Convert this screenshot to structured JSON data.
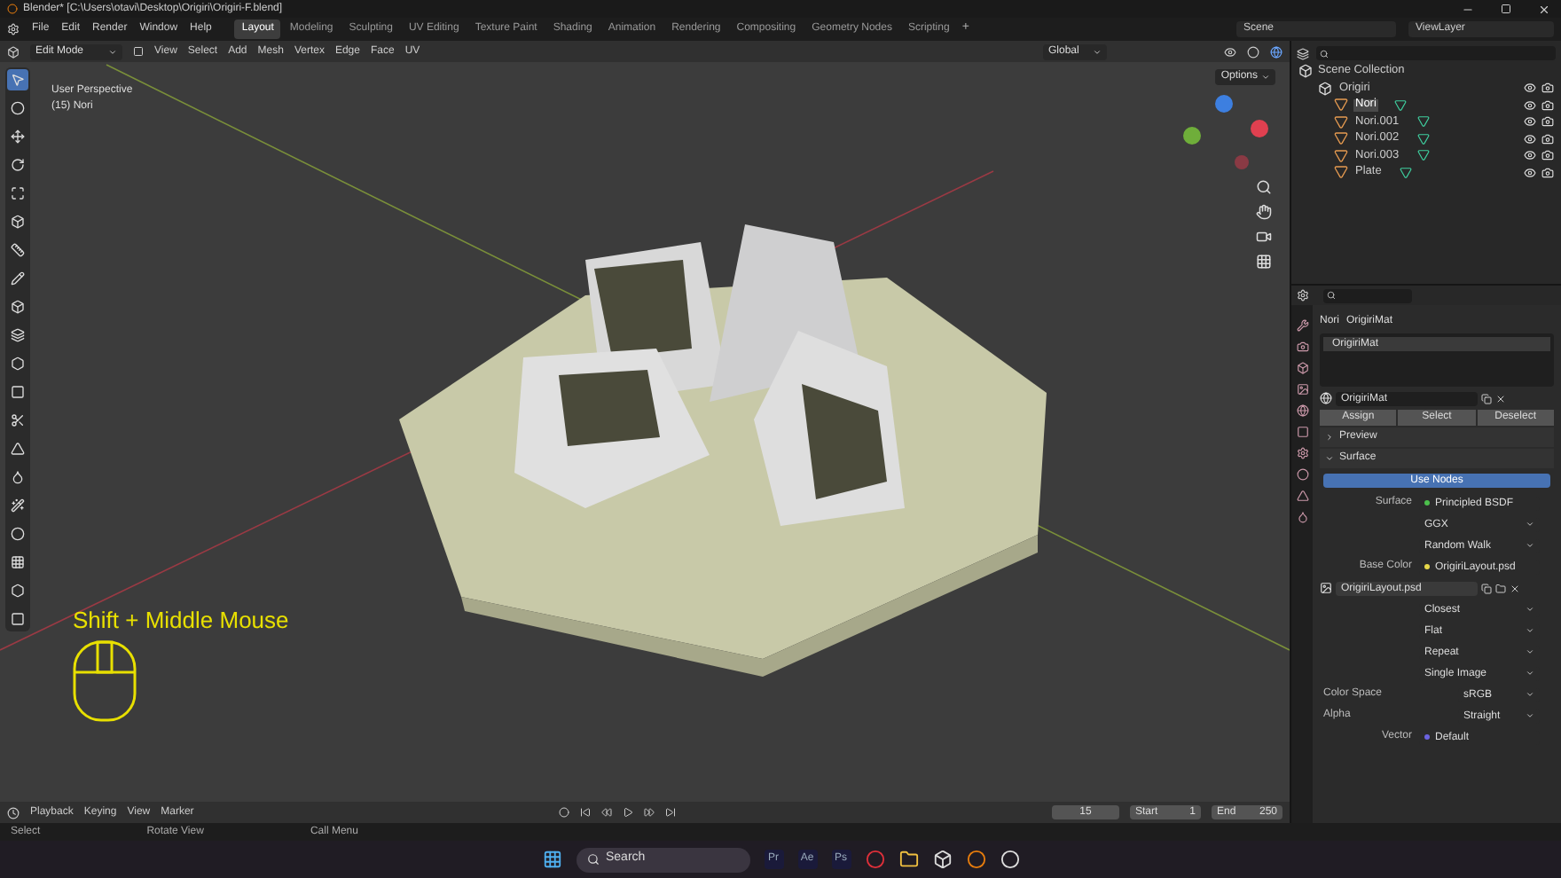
{
  "window": {
    "title": "Blender* [C:\\Users\\otavi\\Desktop\\Origiri\\Origiri-F.blend]"
  },
  "menu": [
    "File",
    "Edit",
    "Render",
    "Window",
    "Help"
  ],
  "workspaces": [
    {
      "label": "Layout",
      "selected": true
    },
    {
      "label": "Modeling",
      "selected": false
    },
    {
      "label": "Sculpting",
      "selected": false
    },
    {
      "label": "UV Editing",
      "selected": false
    },
    {
      "label": "Texture Paint",
      "selected": false
    },
    {
      "label": "Shading",
      "selected": false
    },
    {
      "label": "Animation",
      "selected": false
    },
    {
      "label": "Rendering",
      "selected": false
    },
    {
      "label": "Compositing",
      "selected": false
    },
    {
      "label": "Geometry Nodes",
      "selected": false
    },
    {
      "label": "Scripting",
      "selected": false
    }
  ],
  "add_tab": "+",
  "scene": "Scene",
  "view_layer": "ViewLayer",
  "viewport_header": {
    "mode": "Edit Mode",
    "menus": [
      "View",
      "Select",
      "Add",
      "Mesh",
      "Vertex",
      "Edge",
      "Face",
      "UV"
    ],
    "orientation": "Global",
    "options": "Options"
  },
  "viewport": {
    "view_name": "User Perspective",
    "object_label": "(15) Nori",
    "hint": "Shift + Middle Mouse"
  },
  "toolbar": [
    {
      "selected": true
    },
    {
      "selected": false
    },
    {
      "selected": false
    },
    {
      "selected": false
    },
    {
      "selected": false
    },
    {
      "selected": false
    },
    {
      "selected": false
    },
    {
      "selected": false
    },
    {
      "selected": false
    },
    {
      "selected": false
    },
    {
      "selected": false
    },
    {
      "selected": false
    },
    {
      "selected": false
    },
    {
      "selected": false
    },
    {
      "selected": false
    },
    {
      "selected": false
    },
    {
      "selected": false
    },
    {
      "selected": false
    },
    {
      "selected": false
    },
    {
      "selected": false
    }
  ],
  "outliner": {
    "label": "Scene Collection",
    "children": [
      {
        "label": "Origiri",
        "kind": "collection",
        "children": [
          {
            "label": "Nori",
            "kind": "mesh",
            "selected": true
          },
          {
            "label": "Nori.001",
            "kind": "mesh",
            "selected": false
          },
          {
            "label": "Nori.002",
            "kind": "mesh",
            "selected": false
          },
          {
            "label": "Nori.003",
            "kind": "mesh",
            "selected": false
          },
          {
            "label": "Plate",
            "kind": "mesh",
            "selected": false
          }
        ]
      }
    ]
  },
  "properties": {
    "breadcrumb": [
      "Nori",
      "OrigiriMat"
    ],
    "slots": [
      "OrigiriMat"
    ],
    "material": "OrigiriMat",
    "slot_buttons": [
      "Assign",
      "Select",
      "Deselect"
    ],
    "panels": [
      {
        "label": "Preview",
        "expanded": false
      },
      {
        "label": "Surface",
        "expanded": true
      }
    ],
    "use_nodes": "Use Nodes",
    "rows": [
      {
        "kind": "link",
        "label": "Surface",
        "value": "Principled BSDF",
        "color": "#4cc04c"
      },
      {
        "kind": "dropdown",
        "value": "GGX"
      },
      {
        "kind": "dropdown",
        "value": "Random Walk"
      },
      {
        "kind": "link",
        "label": "Base Color",
        "value": "OrigiriLayout.psd",
        "color": "#e6d84a"
      },
      {
        "kind": "image",
        "value": "OrigiriLayout.psd"
      },
      {
        "kind": "dropdown",
        "value": "Closest"
      },
      {
        "kind": "dropdown",
        "value": "Flat"
      },
      {
        "kind": "dropdown",
        "value": "Repeat"
      },
      {
        "kind": "dropdown",
        "value": "Single Image"
      },
      {
        "kind": "short",
        "label": "Color Space",
        "value": "sRGB"
      },
      {
        "kind": "short",
        "label": "Alpha",
        "value": "Straight"
      },
      {
        "kind": "link",
        "label": "Vector",
        "value": "Default",
        "color": "#6b63e0"
      }
    ]
  },
  "timeline": {
    "menus": [
      "Playback",
      "Keying",
      "View",
      "Marker"
    ],
    "frame": "15",
    "start_label": "Start",
    "start": "1",
    "end_label": "End",
    "end": "250"
  },
  "status_bar": [
    "Select",
    "Rotate View",
    "Call Menu"
  ],
  "taskbar": {
    "search": "Search",
    "apps": [
      "Pr",
      "Ae",
      "Ps"
    ]
  }
}
